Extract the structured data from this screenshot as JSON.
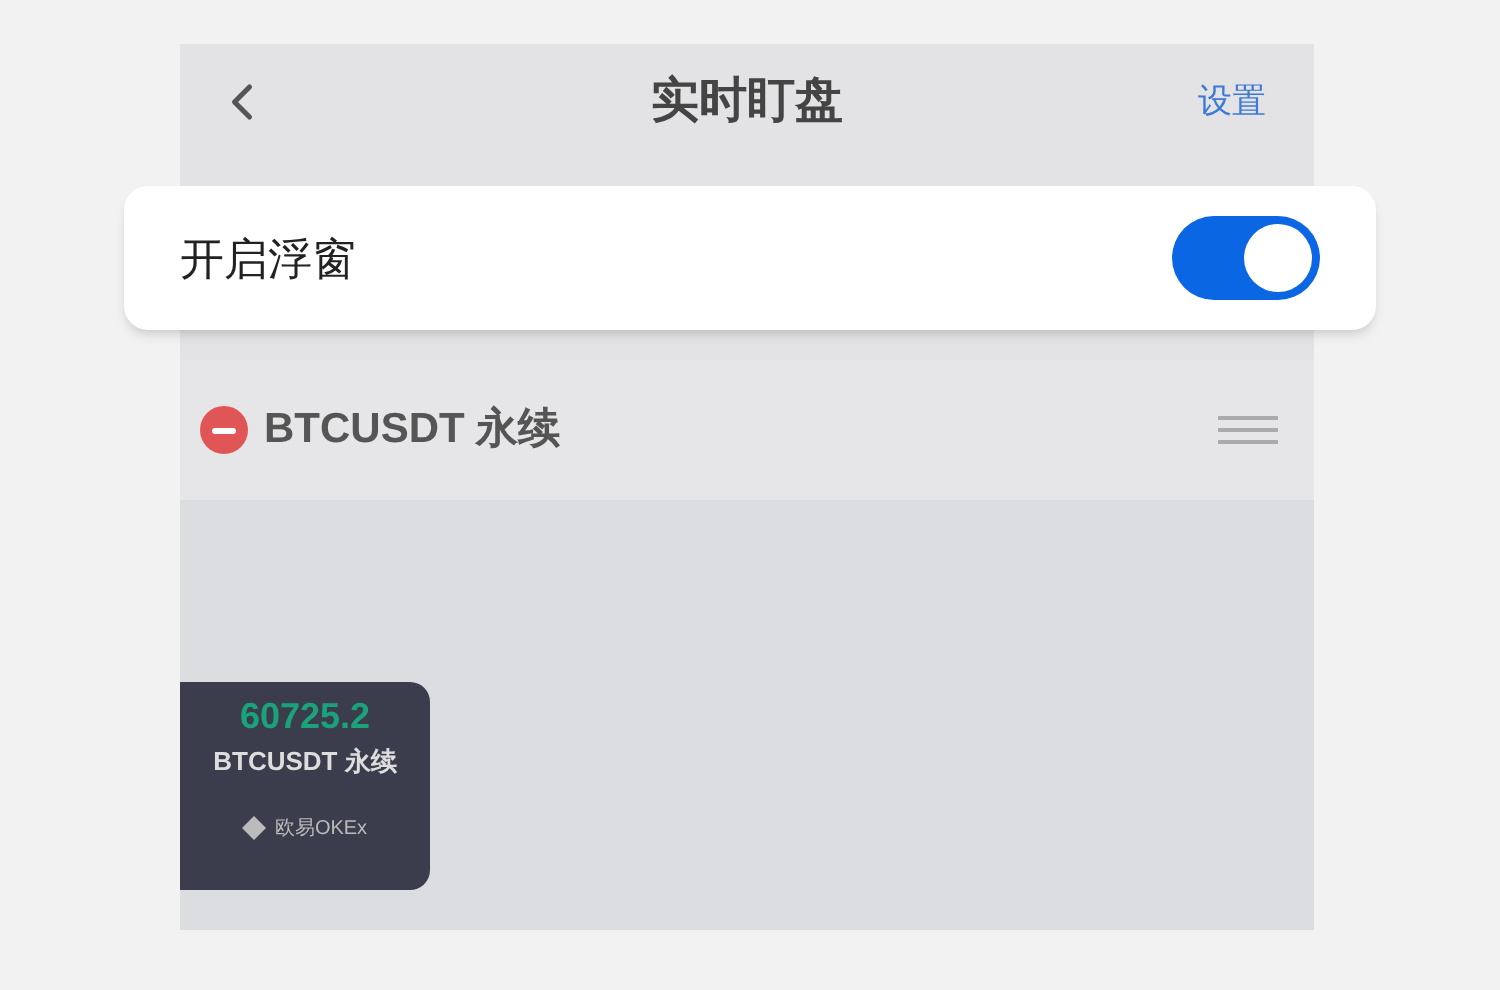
{
  "header": {
    "title": "实时盯盘",
    "action": "设置"
  },
  "float_toggle": {
    "label": "开启浮窗",
    "on": true
  },
  "watch_list": [
    {
      "symbol": "BTCUSDT 永续"
    }
  ],
  "floating_window": {
    "price": "60725.2",
    "symbol": "BTCUSDT 永续",
    "brand": "欧易OKEx"
  }
}
